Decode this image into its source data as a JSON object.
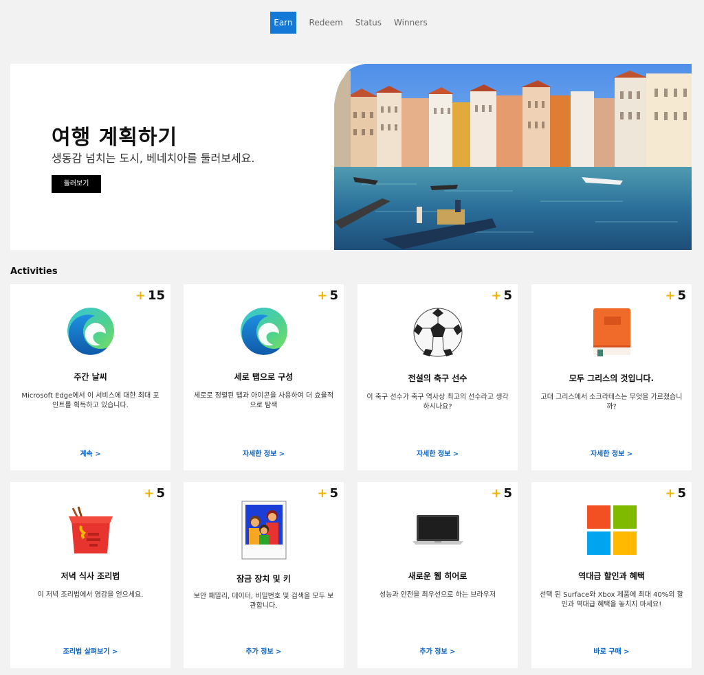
{
  "nav": {
    "tabs": [
      {
        "label": "Earn",
        "active": true
      },
      {
        "label": "Redeem",
        "active": false
      },
      {
        "label": "Status",
        "active": false
      },
      {
        "label": "Winners",
        "active": false
      }
    ]
  },
  "hero": {
    "title": "여행 계획하기",
    "subtitle": "생동감 넘치는 도시, 베네치아를 둘러보세요.",
    "button_label": "둘러보기"
  },
  "activities": {
    "heading": "Activities",
    "plus_symbol": "+",
    "cards": [
      {
        "points": "15",
        "icon": "edge-logo-icon",
        "title": "주간 날씨",
        "description": "Microsoft Edge에서 이 서비스에 대한 최대 포인트를 획득하고 있습니다.",
        "link": "계속 >"
      },
      {
        "points": "5",
        "icon": "edge-logo-icon",
        "title": "세로 탭으로 구성",
        "description": "세로로 정렬된 탭과 아이콘을 사용하여 더 효율적으로 탐색",
        "link": "자세한 정보 >"
      },
      {
        "points": "5",
        "icon": "soccer-ball-icon",
        "title": "전설의 축구 선수",
        "description": "이 축구 선수가 축구 역사상 최고의 선수라고 생각하시나요?",
        "link": "자세한 정보 >"
      },
      {
        "points": "5",
        "icon": "book-icon",
        "title": "모두 그리스의 것입니다.",
        "description": "고대 그리스에서 소크라테스는 무엇을 가르쳤습니까?",
        "link": "자세한 정보 >"
      },
      {
        "points": "5",
        "icon": "takeout-box-icon",
        "title": "저녁 식사 조리법",
        "description": "이 저녁 조리법에서 영감을 얻으세요.",
        "link": "조리법 살펴보기 >"
      },
      {
        "points": "5",
        "icon": "family-photo-icon",
        "title": "잠금 장치 및 키",
        "description": "보안 패밀리, 데이터, 비밀번호 및 검색을 모두 보관합니다.",
        "link": "추가 정보 >"
      },
      {
        "points": "5",
        "icon": "laptop-icon",
        "title": "새로운 웹 히어로",
        "description": "성능과 안전을 최우선으로 하는 브라우저",
        "link": "추가 정보 >"
      },
      {
        "points": "5",
        "icon": "microsoft-logo-icon",
        "title": "역대급 할인과 혜택",
        "description": "선택 된 Surface와 Xbox 제품에 최대 40%의 할인과 역대급 혜택을 놓치지 마세요!",
        "link": "바로 구매 >"
      }
    ]
  },
  "colors": {
    "accent": "#1378d6",
    "link": "#0b63c2",
    "points_plus": "#f2b400"
  }
}
